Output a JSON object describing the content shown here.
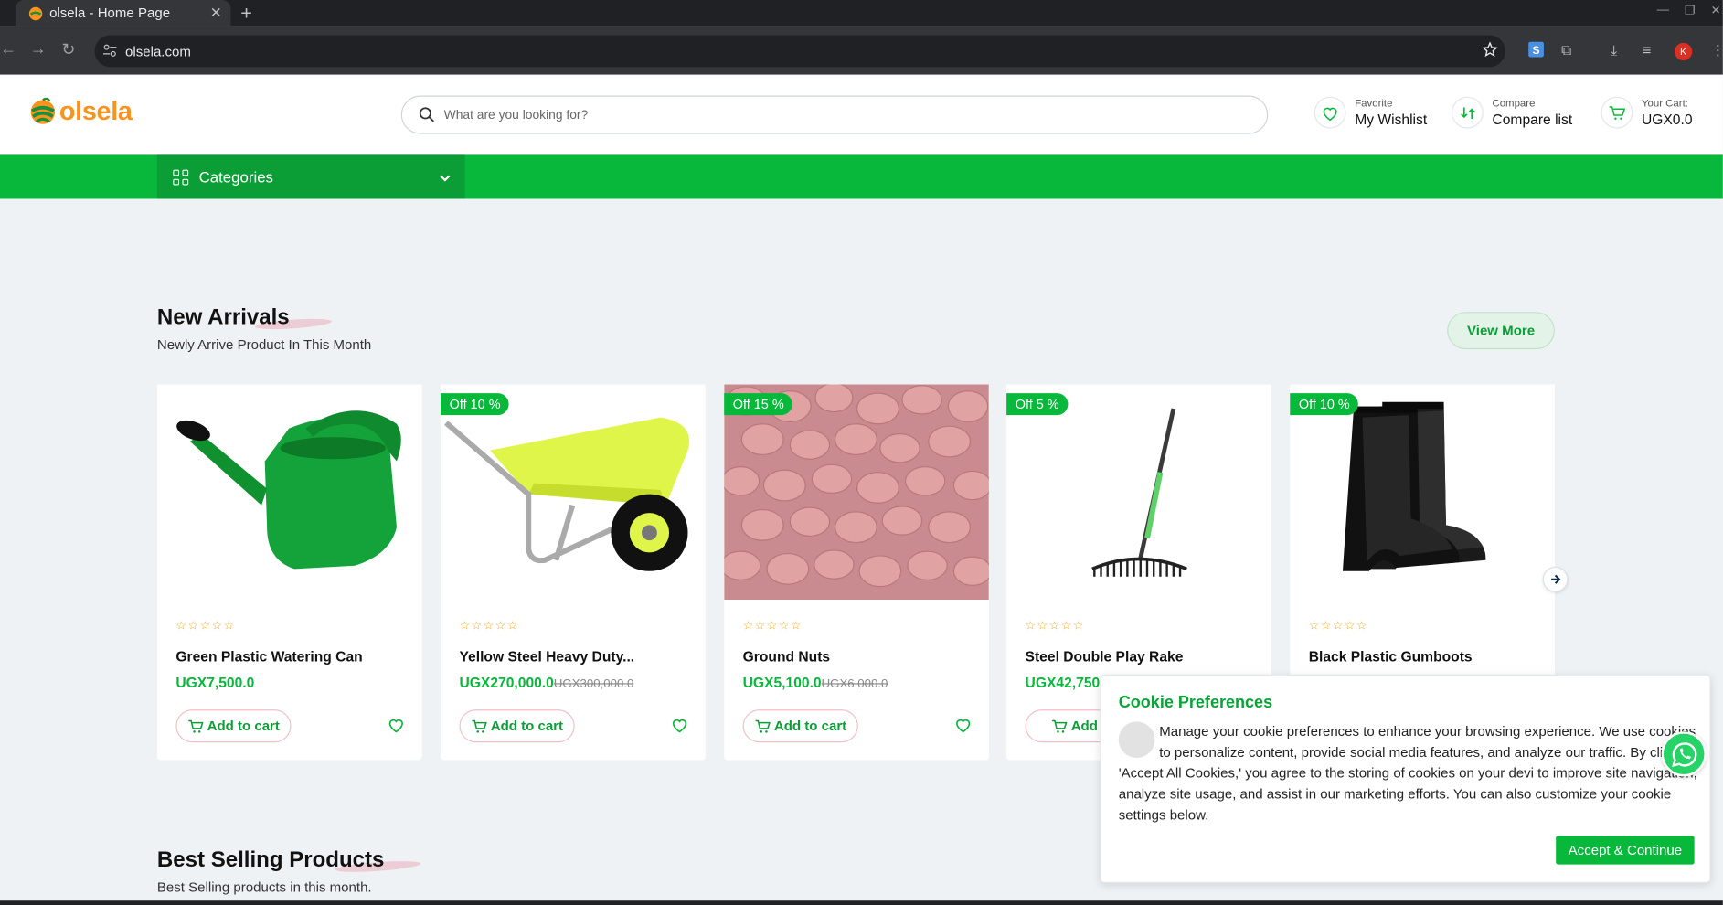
{
  "browser": {
    "tab_title": "olsela - Home Page",
    "url": "olsela.com",
    "avatar_initial": "K"
  },
  "header": {
    "logo_text": "olsela",
    "search_placeholder": "What are you looking for?",
    "wishlist": {
      "small": "Favorite",
      "big": "My Wishlist"
    },
    "compare": {
      "small": "Compare",
      "big": "Compare list"
    },
    "cart": {
      "small": "Your Cart:",
      "big": "UGX0.0"
    }
  },
  "nav": {
    "categories_label": "Categories"
  },
  "new_arrivals": {
    "title": "New Arrivals",
    "subtitle": "Newly Arrive Product In This Month",
    "view_more": "View More",
    "products": [
      {
        "name": "Green Plastic Watering Can",
        "price": "UGX7,500.0",
        "old_price": "",
        "badge": "",
        "add_label": "Add to cart"
      },
      {
        "name": "Yellow Steel Heavy Duty...",
        "price": "UGX270,000.0",
        "old_price": "UGX300,000.0",
        "badge": "Off 10 %",
        "add_label": "Add to cart"
      },
      {
        "name": "Ground Nuts",
        "price": "UGX5,100.0",
        "old_price": "UGX6,000.0",
        "badge": "Off 15 %",
        "add_label": "Add to cart"
      },
      {
        "name": "Steel Double Play Rake",
        "price": "UGX42,750",
        "old_price": "",
        "badge": "Off 5 %",
        "add_label": "Add to"
      },
      {
        "name": "Black Plastic Gumboots",
        "price": "",
        "old_price": "",
        "badge": "Off 10 %",
        "add_label": ""
      }
    ]
  },
  "best_selling": {
    "title": "Best Selling Products",
    "subtitle": "Best Selling products in this month."
  },
  "cookie": {
    "title": "Cookie Preferences",
    "body": "Manage your cookie preferences to enhance your browsing experience. We use cookies to personalize content, provide social media features, and analyze our traffic. By clicking 'Accept All Cookies,' you agree to the storing of cookies on your devi to improve site navigation, analyze site usage, and assist in our marketing efforts. You can also customize your cookie settings below.",
    "accept_label": "Accept & Continue"
  },
  "colors": {
    "brand_green": "#08b83b",
    "brand_orange": "#f7931e"
  }
}
